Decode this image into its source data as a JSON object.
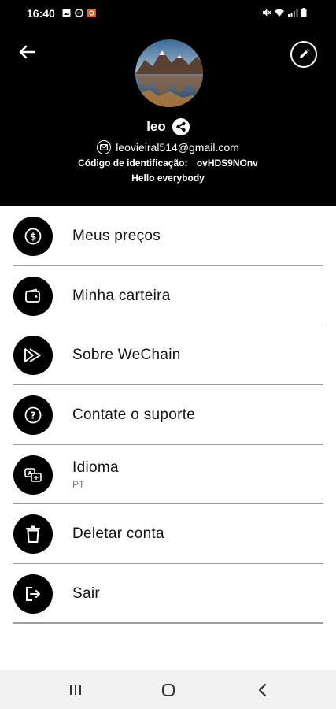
{
  "status_bar": {
    "time": "16:40"
  },
  "profile": {
    "name": "leo",
    "email": "leovieiral514@gmail.com",
    "id_label": "Código de identificação:",
    "id_value": "ovHDS9NOnv",
    "bio": "Hello everybody"
  },
  "menu": {
    "items": [
      {
        "label": "Meus preços",
        "icon": "dollar-icon"
      },
      {
        "label": "Minha carteira",
        "icon": "wallet-icon"
      },
      {
        "label": "Sobre WeChain",
        "icon": "play-icon"
      },
      {
        "label": "Contate o suporte",
        "icon": "help-icon"
      },
      {
        "label": "Idioma",
        "sub": "PT",
        "icon": "translate-icon"
      },
      {
        "label": "Deletar conta",
        "icon": "trash-icon"
      },
      {
        "label": "Sair",
        "icon": "logout-icon"
      }
    ]
  },
  "colors": {
    "header_bg": "#000000",
    "icon_bg": "#000000",
    "divider": "#9e9e9e",
    "nav_bg": "#f2f2f2"
  }
}
